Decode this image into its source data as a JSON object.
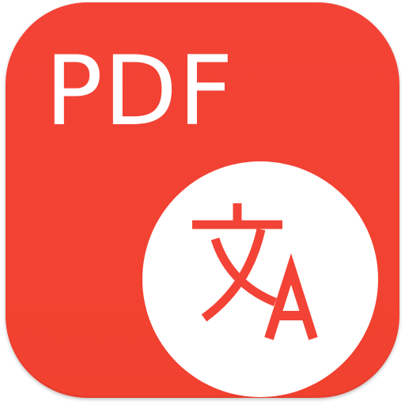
{
  "app": {
    "label": "PDF",
    "icon": "translate-icon",
    "glyph_text": "文A"
  },
  "colors": {
    "background": "#f34336",
    "foreground": "#ffffff",
    "accent": "#f34336"
  }
}
